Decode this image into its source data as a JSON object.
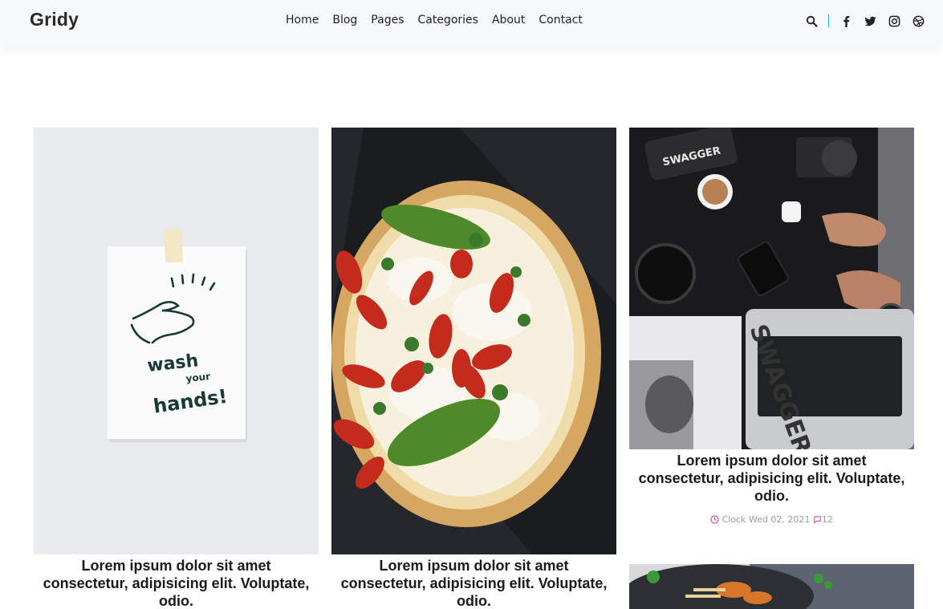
{
  "brand": {
    "logo": "Gridy"
  },
  "nav": [
    "Home",
    "Blog",
    "Pages",
    "Categories",
    "About",
    "Contact"
  ],
  "header_icons": [
    "search-icon",
    "facebook-icon",
    "twitter-icon",
    "instagram-icon",
    "dribbble-icon"
  ],
  "accent_color": "#27b6c9",
  "meta_icon_color": "#c0479d",
  "posts": [
    {
      "image": "wash-your-hands-note",
      "image_text": [
        "wash",
        "your",
        "hands!"
      ],
      "title": "Lorem ipsum dolor sit amet consectetur, adipisicing elit. Voluptate, odio."
    },
    {
      "image": "pizza",
      "title": "Lorem ipsum dolor sit amet consectetur, adipisicing elit. Voluptate, odio."
    },
    {
      "image": "workspace-flatlay",
      "image_text": [
        "SWAGGER",
        "SWAGGER"
      ],
      "title": "Lorem ipsum dolor sit amet consectetur, adipisicing elit. Voluptate, odio.",
      "meta": {
        "date": "Clock Wed 02, 2021",
        "comments": "12"
      }
    },
    {
      "image": "food-bowl"
    }
  ]
}
